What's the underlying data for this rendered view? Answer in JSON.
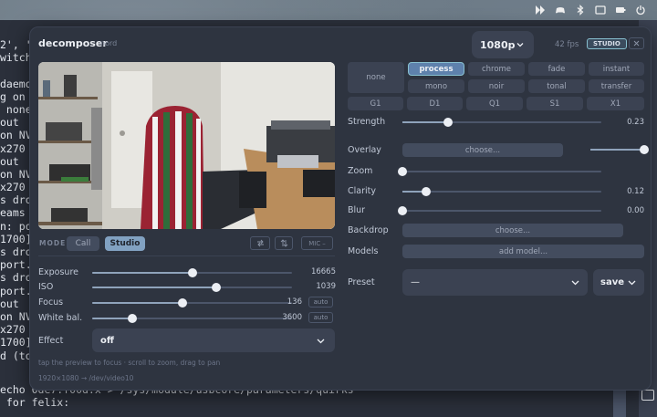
{
  "terminal": {
    "lines": [
      "2', 'c",
      "witch'",
      "",
      "daemon",
      "g on /",
      " none,",
      "out  /",
      "on NVI",
      "x270 n",
      "out  /",
      "on NVI",
      "x270 n",
      "s drop",
      "eams fo",
      "n: pow",
      "1700]",
      "s drop",
      "port.",
      "s drop",
      "port.",
      "out  /",
      "on NVI",
      "x270 n",
      "1700]",
      "d (tot"
    ],
    "bottom_lines": [
      "echo 0de7:f00d:x > /sys/module/usbcore/parameters/quirks",
      " for felix:"
    ]
  },
  "app": {
    "title": "decomposer",
    "theme": "nord",
    "resolution": "1080p",
    "fps": "42 fps",
    "mode_badge": "STUDIO"
  },
  "mode": {
    "label": "MODE",
    "options": [
      "Call",
      "Studio"
    ],
    "selected": "Studio",
    "mic_label": "MIC"
  },
  "camera": {
    "exposure": {
      "label": "Exposure",
      "value": "16665",
      "level": 0.5
    },
    "iso": {
      "label": "ISO",
      "value": "1039",
      "level": 0.62
    },
    "focus": {
      "label": "Focus",
      "value": "136",
      "level": 0.45,
      "auto_label": "auto"
    },
    "white_balance": {
      "label": "White bal.",
      "value": "3600",
      "level": 0.2,
      "auto_label": "auto"
    }
  },
  "effect": {
    "label": "Effect",
    "value": "off"
  },
  "hint": "tap the preview to focus · scroll to zoom, drag to pan",
  "device": "1920×1080 → /dev/video10",
  "filters": {
    "none": "none",
    "row1": [
      "process",
      "chrome",
      "fade",
      "instant"
    ],
    "row2": [
      "mono",
      "noir",
      "tonal",
      "transfer"
    ],
    "row3": [
      "G1",
      "D1",
      "Q1",
      "S1",
      "X1"
    ],
    "selected": "process"
  },
  "strength": {
    "label": "Strength",
    "value": "0.23",
    "level": 0.23
  },
  "overlay": {
    "label": "Overlay",
    "button": "choose...",
    "level": 1.0
  },
  "zoom": {
    "label": "Zoom",
    "level": 0.0
  },
  "clarity": {
    "label": "Clarity",
    "value": "0.12",
    "level": 0.12
  },
  "blur": {
    "label": "Blur",
    "value": "0.00",
    "level": 0.0
  },
  "backdrop": {
    "label": "Backdrop",
    "button": "choose..."
  },
  "models": {
    "label": "Models",
    "button": "add model..."
  },
  "preset": {
    "label": "Preset",
    "value": "—",
    "save_label": "save"
  }
}
